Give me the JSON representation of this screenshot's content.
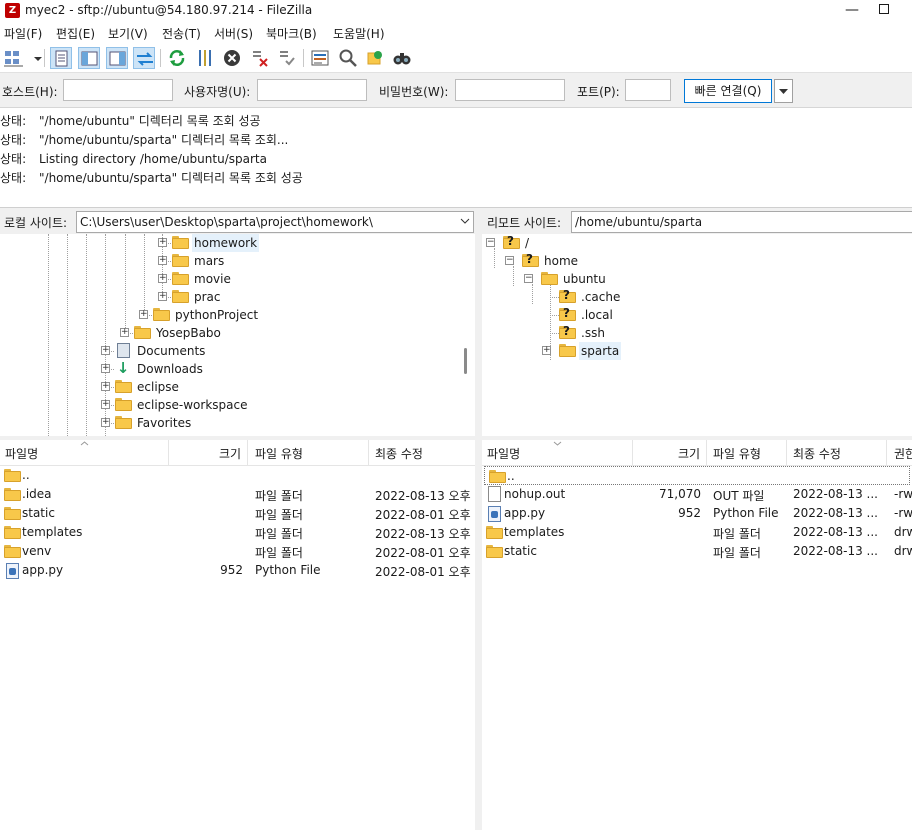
{
  "window": {
    "title": "myec2 - sftp://ubuntu@54.180.97.214 - FileZilla",
    "app_icon": "filezilla-icon"
  },
  "menu": [
    "파일(F)",
    "편집(E)",
    "보기(V)",
    "전송(T)",
    "서버(S)",
    "북마크(B)",
    "도움말(H)"
  ],
  "toolbar": [
    "site-manager-icon",
    "dropdown-arrow-icon",
    "toggle-log-icon",
    "toggle-local-tree-icon",
    "toggle-remote-tree-icon",
    "toggle-queue-icon",
    "refresh-icon",
    "process-queue-icon",
    "cancel-icon",
    "disconnect-icon",
    "reconnect-icon",
    "filter-icon",
    "search-icon",
    "sync-browse-icon",
    "compare-icon"
  ],
  "quickconnect": {
    "host_label": "호스트(H):",
    "user_label": "사용자명(U):",
    "pass_label": "비밀번호(W):",
    "port_label": "포트(P):",
    "host_value": "",
    "user_value": "",
    "pass_value": "",
    "port_value": "",
    "connect_label": "빠른 연결(Q)"
  },
  "log": [
    {
      "key": "상태:",
      "text": "\"/home/ubuntu\" 디렉터리 목록 조회 성공"
    },
    {
      "key": "상태:",
      "text": "\"/home/ubuntu/sparta\" 디렉터리 목록 조회..."
    },
    {
      "key": "상태:",
      "text": "Listing directory /home/ubuntu/sparta"
    },
    {
      "key": "상태:",
      "text": "\"/home/ubuntu/sparta\" 디렉터리 목록 조회 성공"
    }
  ],
  "local": {
    "site_label": "로컬 사이트:",
    "path": "C:\\Users\\user\\Desktop\\sparta\\project\\homework\\",
    "tree": [
      "homework",
      "mars",
      "movie",
      "prac",
      "pythonProject",
      "YosepBabo",
      "Documents",
      "Downloads",
      "eclipse",
      "eclipse-workspace",
      "Favorites"
    ],
    "columns": [
      "파일명",
      "크기",
      "파일 유형",
      "최종 수정"
    ],
    "files": [
      {
        "name": "..",
        "size": "",
        "type": "",
        "modified": ""
      },
      {
        "name": ".idea",
        "size": "",
        "type": "파일 폴더",
        "modified": "2022-08-13 오후"
      },
      {
        "name": "static",
        "size": "",
        "type": "파일 폴더",
        "modified": "2022-08-01 오후"
      },
      {
        "name": "templates",
        "size": "",
        "type": "파일 폴더",
        "modified": "2022-08-13 오후"
      },
      {
        "name": "venv",
        "size": "",
        "type": "파일 폴더",
        "modified": "2022-08-01 오후"
      },
      {
        "name": "app.py",
        "size": "952",
        "type": "Python File",
        "modified": "2022-08-01 오후"
      }
    ]
  },
  "remote": {
    "site_label": "리모트 사이트:",
    "path": "/home/ubuntu/sparta",
    "tree": [
      "/",
      "home",
      "ubuntu",
      ".cache",
      ".local",
      ".ssh",
      "sparta"
    ],
    "columns": [
      "파일명",
      "크기",
      "파일 유형",
      "최종 수정",
      "권한"
    ],
    "files": [
      {
        "name": "..",
        "size": "",
        "type": "",
        "modified": "",
        "perm": ""
      },
      {
        "name": "nohup.out",
        "size": "71,070",
        "type": "OUT 파일",
        "modified": "2022-08-13 ...",
        "perm": "-rw"
      },
      {
        "name": "app.py",
        "size": "952",
        "type": "Python File",
        "modified": "2022-08-13 ...",
        "perm": "-rw"
      },
      {
        "name": "templates",
        "size": "",
        "type": "파일 폴더",
        "modified": "2022-08-13 ...",
        "perm": "drw"
      },
      {
        "name": "static",
        "size": "",
        "type": "파일 폴더",
        "modified": "2022-08-13 ...",
        "perm": "drw"
      }
    ]
  }
}
